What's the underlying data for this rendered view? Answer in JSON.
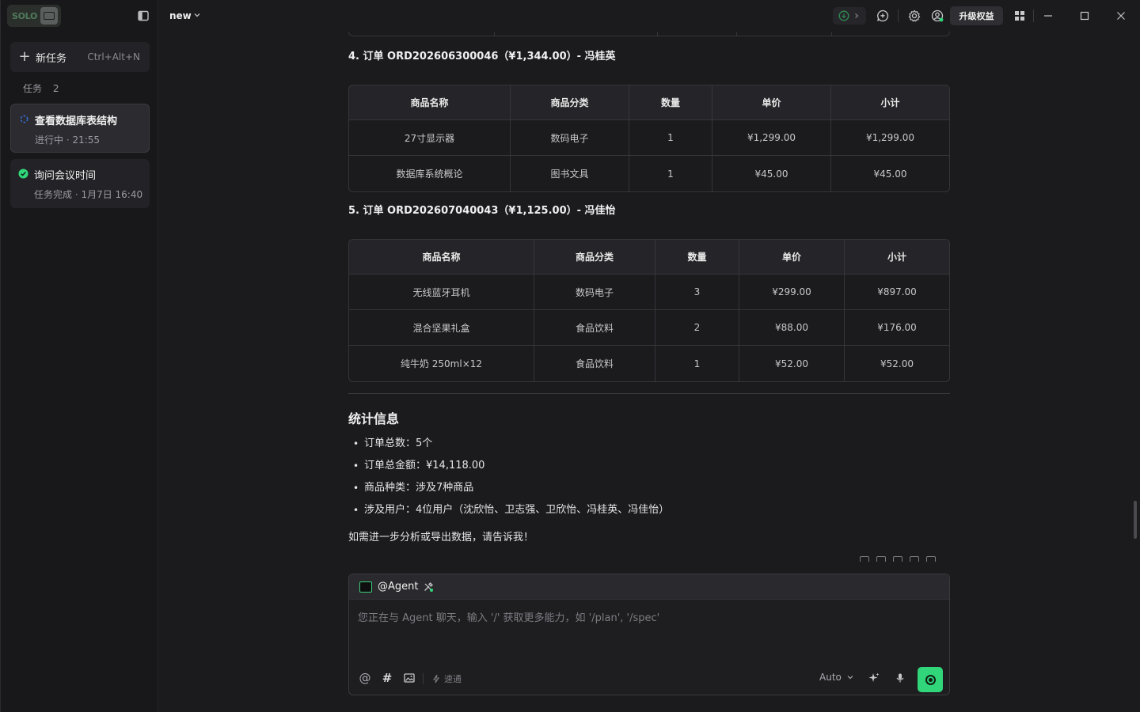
{
  "app": {
    "logo_text": "SOLO",
    "tab_name": "new",
    "upgrade_label": "升级权益"
  },
  "sidebar": {
    "new_task_label": "新任务",
    "new_task_shortcut": "Ctrl+Alt+N",
    "tasks_heading": "任务",
    "tasks_count": "2",
    "tasks": [
      {
        "title": "查看数据库表结构",
        "subtitle": "进行中 · 21:55",
        "status": "running"
      },
      {
        "title": "询问会议时间",
        "subtitle": "任务完成 · 1月7日 16:40",
        "status": "done"
      }
    ]
  },
  "orders": [
    {
      "title": "4. 订单 ORD202606300046（¥1,344.00）- 冯桂英",
      "headers": [
        "商品名称",
        "商品分类",
        "数量",
        "单价",
        "小计"
      ],
      "rows": [
        [
          "27寸显示器",
          "数码电子",
          "1",
          "¥1,299.00",
          "¥1,299.00"
        ],
        [
          "数据库系统概论",
          "图书文具",
          "1",
          "¥45.00",
          "¥45.00"
        ]
      ]
    },
    {
      "title": "5. 订单 ORD202607040043（¥1,125.00）- 冯佳怡",
      "headers": [
        "商品名称",
        "商品分类",
        "数量",
        "单价",
        "小计"
      ],
      "rows": [
        [
          "无线蓝牙耳机",
          "数码电子",
          "3",
          "¥299.00",
          "¥897.00"
        ],
        [
          "混合坚果礼盒",
          "食品饮料",
          "2",
          "¥88.00",
          "¥176.00"
        ],
        [
          "纯牛奶 250ml×12",
          "食品饮料",
          "1",
          "¥52.00",
          "¥52.00"
        ]
      ]
    }
  ],
  "stats": {
    "title": "统计信息",
    "items": [
      "订单总数：5个",
      "订单总金额：¥14,118.00",
      "商品种类：涉及7种商品",
      "涉及用户：4位用户（沈欣怡、卫志强、卫欣怡、冯桂英、冯佳怡）"
    ],
    "closing": "如需进一步分析或导出数据，请告诉我！"
  },
  "composer": {
    "agent_label": "@Agent",
    "placeholder": "您正在与 Agent 聊天，输入 '/' 获取更多能力，如 '/plan', '/spec'",
    "speed_label": "速通",
    "model_label": "Auto"
  },
  "colors": {
    "accent": "#31d67b",
    "background": "#1b1b1e",
    "sidebar": "#18181b"
  }
}
